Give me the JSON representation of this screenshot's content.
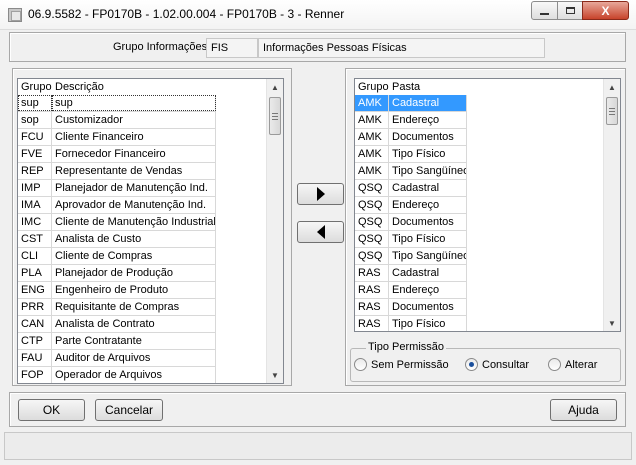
{
  "window": {
    "title": "06.9.5582 - FP0170B - 1.02.00.004 - FP0170B - 3 - Renner",
    "close_label": "X"
  },
  "group_info": {
    "label": "Grupo Informações:",
    "code": "FIS",
    "description": "Informações Pessoas Físicas"
  },
  "left_grid": {
    "headers": [
      "Grupo",
      "Descrição"
    ],
    "rows": [
      [
        "sup",
        "sup"
      ],
      [
        "sop",
        "Customizador"
      ],
      [
        "FCU",
        "Cliente Financeiro"
      ],
      [
        "FVE",
        "Fornecedor Financeiro"
      ],
      [
        "REP",
        "Representante de Vendas"
      ],
      [
        "IMP",
        "Planejador de Manutenção Ind."
      ],
      [
        "IMA",
        "Aprovador de Manutenção Ind."
      ],
      [
        "IMC",
        "Cliente de Manutenção Industrial"
      ],
      [
        "CST",
        "Analista de Custo"
      ],
      [
        "CLI",
        "Cliente de Compras"
      ],
      [
        "PLA",
        "Planejador de Produção"
      ],
      [
        "ENG",
        "Engenheiro de Produto"
      ],
      [
        "PRR",
        "Requisitante de Compras"
      ],
      [
        "CAN",
        "Analista de Contrato"
      ],
      [
        "CTP",
        "Parte Contratante"
      ],
      [
        "FAU",
        "Auditor de Arquivos"
      ],
      [
        "FOP",
        "Operador de Arquivos"
      ]
    ]
  },
  "right_grid": {
    "headers": [
      "Grupo",
      "Pasta"
    ],
    "rows": [
      [
        "AMK",
        "Cadastral"
      ],
      [
        "AMK",
        "Endereço"
      ],
      [
        "AMK",
        "Documentos"
      ],
      [
        "AMK",
        "Tipo Físico"
      ],
      [
        "AMK",
        "Tipo Sangüíneo"
      ],
      [
        "QSQ",
        "Cadastral"
      ],
      [
        "QSQ",
        "Endereço"
      ],
      [
        "QSQ",
        "Documentos"
      ],
      [
        "QSQ",
        "Tipo Físico"
      ],
      [
        "QSQ",
        "Tipo Sangüíneo"
      ],
      [
        "RAS",
        "Cadastral"
      ],
      [
        "RAS",
        "Endereço"
      ],
      [
        "RAS",
        "Documentos"
      ],
      [
        "RAS",
        "Tipo Físico"
      ]
    ]
  },
  "permission": {
    "legend": "Tipo Permissão",
    "options": [
      "Sem Permissão",
      "Consultar",
      "Alterar"
    ],
    "selected": "Consultar"
  },
  "buttons": {
    "ok": "OK",
    "cancel": "Cancelar",
    "help": "Ajuda"
  },
  "icons": {
    "move_right": "triangle-right-icon",
    "move_left": "triangle-left-icon",
    "scroll_up": "triangle-up-icon",
    "scroll_down": "triangle-down-icon"
  },
  "colors": {
    "selection": "#3399ff",
    "close_button": "#c7432b"
  }
}
